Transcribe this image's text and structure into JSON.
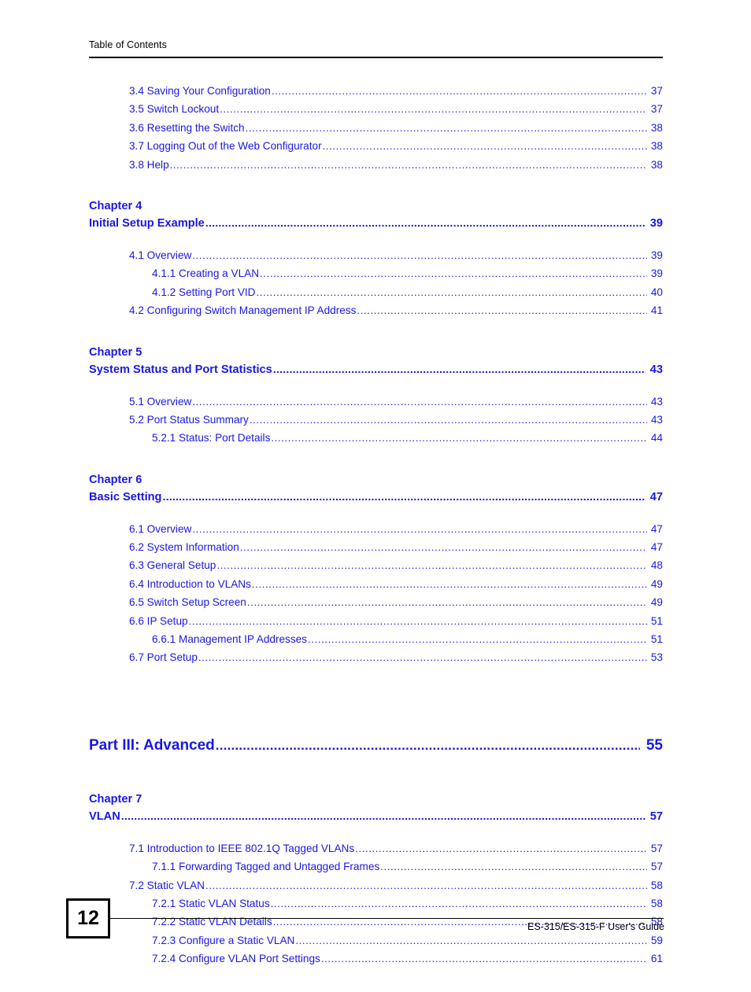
{
  "header": {
    "title": "Table of Contents"
  },
  "toc": {
    "groups": [
      {
        "type": "entries",
        "entries": [
          {
            "level": 2,
            "label": "3.4 Saving Your Configuration",
            "page": "37"
          },
          {
            "level": 2,
            "label": "3.5 Switch Lockout",
            "page": "37"
          },
          {
            "level": 2,
            "label": "3.6 Resetting the Switch",
            "page": "38"
          },
          {
            "level": 2,
            "label": "3.7 Logging Out of the Web Configurator",
            "page": "38"
          },
          {
            "level": 2,
            "label": "3.8 Help",
            "page": "38"
          }
        ]
      },
      {
        "type": "chapter",
        "chapter_label": "Chapter  4",
        "title": "Initial Setup Example",
        "page": "39",
        "entries": [
          {
            "level": 2,
            "label": "4.1 Overview",
            "page": "39"
          },
          {
            "level": 3,
            "label": "4.1.1 Creating a VLAN",
            "page": "39"
          },
          {
            "level": 3,
            "label": "4.1.2 Setting Port VID",
            "page": "40"
          },
          {
            "level": 2,
            "label": "4.2 Configuring Switch Management IP Address",
            "page": "41"
          }
        ]
      },
      {
        "type": "chapter",
        "chapter_label": "Chapter  5",
        "title": "System Status and Port Statistics",
        "page": "43",
        "entries": [
          {
            "level": 2,
            "label": "5.1 Overview",
            "page": "43"
          },
          {
            "level": 2,
            "label": "5.2 Port Status Summary",
            "page": "43"
          },
          {
            "level": 3,
            "label": "5.2.1 Status: Port Details",
            "page": "44"
          }
        ]
      },
      {
        "type": "chapter",
        "chapter_label": "Chapter  6",
        "title": "Basic Setting ",
        "page": "47",
        "entries": [
          {
            "level": 2,
            "label": "6.1 Overview",
            "page": "47"
          },
          {
            "level": 2,
            "label": "6.2 System Information",
            "page": "47"
          },
          {
            "level": 2,
            "label": "6.3 General Setup",
            "page": "48"
          },
          {
            "level": 2,
            "label": "6.4 Introduction to VLANs",
            "page": "49"
          },
          {
            "level": 2,
            "label": "6.5 Switch Setup Screen",
            "page": "49"
          },
          {
            "level": 2,
            "label": "6.6 IP Setup",
            "page": "51"
          },
          {
            "level": 3,
            "label": "6.6.1 Management IP Addresses",
            "page": "51"
          },
          {
            "level": 2,
            "label": "6.7 Port Setup",
            "page": "53"
          }
        ]
      },
      {
        "type": "part",
        "title": "Part III: Advanced",
        "page": "55"
      },
      {
        "type": "chapter",
        "chapter_label": "Chapter  7",
        "title": "VLAN ",
        "page": "57",
        "entries": [
          {
            "level": 2,
            "label": "7.1 Introduction to IEEE 802.1Q Tagged VLANs",
            "page": "57"
          },
          {
            "level": 3,
            "label": "7.1.1 Forwarding Tagged and Untagged Frames",
            "page": "57"
          },
          {
            "level": 2,
            "label": "7.2 Static VLAN",
            "page": "58"
          },
          {
            "level": 3,
            "label": "7.2.1 Static VLAN Status",
            "page": "58"
          },
          {
            "level": 3,
            "label": "7.2.2 Static VLAN Details",
            "page": "58"
          },
          {
            "level": 3,
            "label": "7.2.3 Configure a Static VLAN",
            "page": "59"
          },
          {
            "level": 3,
            "label": "7.2.4 Configure VLAN Port Settings",
            "page": "61"
          }
        ]
      }
    ]
  },
  "footer": {
    "page_number": "12",
    "guide": "ES-315/ES-315-F User's Guide"
  },
  "colors": {
    "link_blue": "#1a17e8",
    "text_black": "#000000"
  }
}
